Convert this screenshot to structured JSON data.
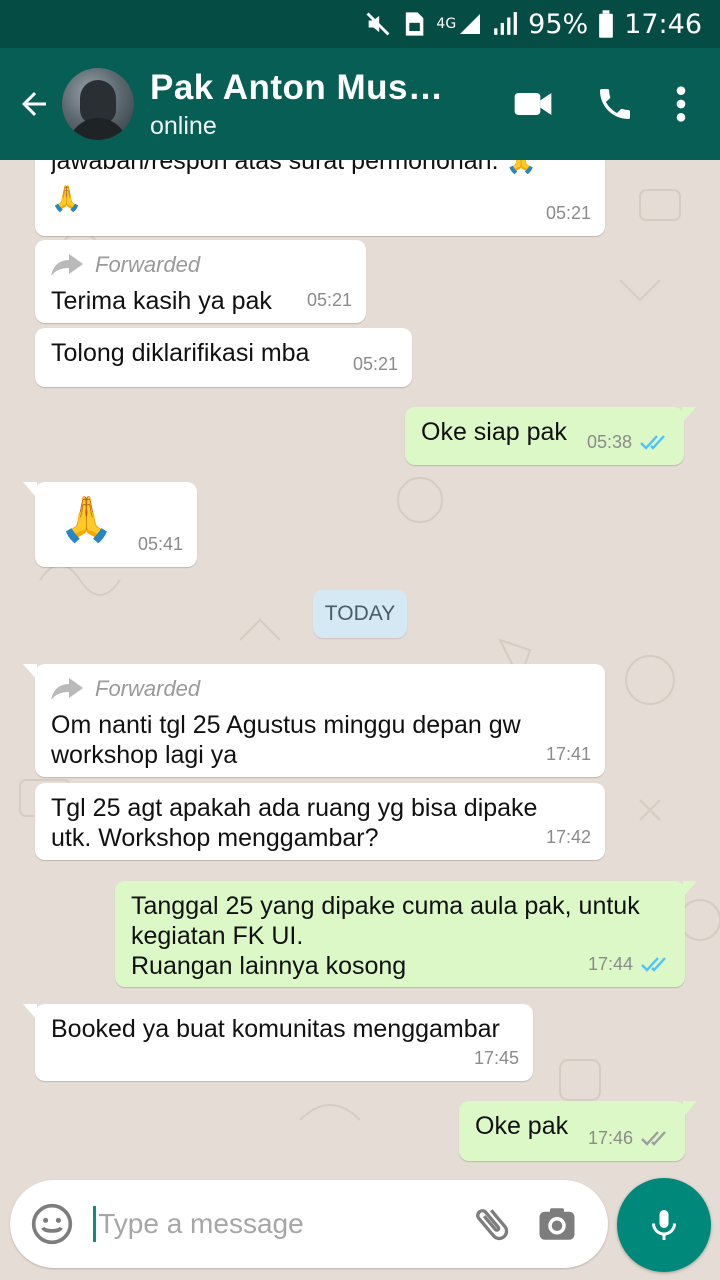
{
  "status_bar": {
    "network": "4G",
    "battery": "95%",
    "time": "17:46"
  },
  "header": {
    "contact_name": "Pak Anton Muski…",
    "status": "online",
    "icons": [
      "back-arrow-icon",
      "video-call-icon",
      "phone-icon",
      "more-vert-icon"
    ]
  },
  "colors": {
    "header": "#075e54",
    "status_bar": "#054d44",
    "outgoing_bubble": "#dcf8c6",
    "incoming_bubble": "#ffffff",
    "read_ticks": "#4fc3f7",
    "mic_button": "#00897b",
    "wallpaper": "#e5ddd5"
  },
  "messages": [
    {
      "direction": "in",
      "text": "jawaban/respon atas surat permohonan. 🙏",
      "text2": "🙏",
      "time": "05:21"
    },
    {
      "direction": "in",
      "forwarded_label": "Forwarded",
      "text": "Terima kasih ya pak",
      "time": "05:21"
    },
    {
      "direction": "in",
      "text": "Tolong diklarifikasi mba",
      "time": "05:21"
    },
    {
      "direction": "out",
      "text": "Oke siap pak",
      "time": "05:38",
      "ticks": "read"
    },
    {
      "direction": "in",
      "text": "🙏",
      "time": "05:41"
    },
    {
      "direction": "in",
      "forwarded_label": "Forwarded",
      "text": "Om nanti tgl 25 Agustus minggu depan gw workshop lagi ya",
      "time": "17:41"
    },
    {
      "direction": "in",
      "text": "Tgl 25 agt apakah ada ruang yg bisa dipake utk. Workshop menggambar?",
      "time": "17:42"
    },
    {
      "direction": "out",
      "text": "Tanggal 25 yang dipake cuma aula pak, untuk kegiatan FK UI.\nRuangan lainnya kosong",
      "time": "17:44",
      "ticks": "read"
    },
    {
      "direction": "in",
      "text": "Booked ya buat komunitas menggambar",
      "time": "17:45"
    },
    {
      "direction": "out",
      "text": "Oke pak",
      "time": "17:46",
      "ticks": "delivered"
    }
  ],
  "day_separator": "TODAY",
  "composer": {
    "placeholder": "Type a message",
    "icons": [
      "emoji-icon",
      "attach-icon",
      "camera-icon",
      "mic-icon"
    ]
  }
}
